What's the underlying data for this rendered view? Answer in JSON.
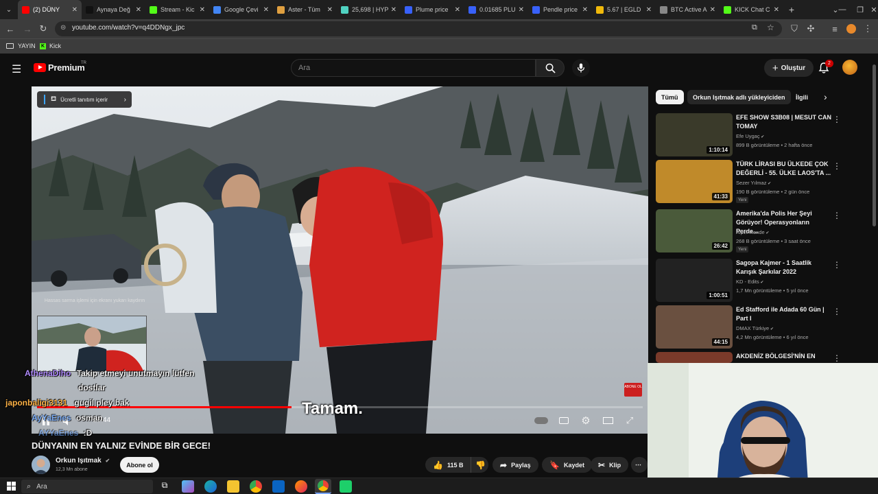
{
  "browser": {
    "tabs": [
      {
        "title": "(2) DÜNY",
        "color": "#ff0000",
        "active": true
      },
      {
        "title": "Aynaya Değ",
        "color": "#111111",
        "active": false
      },
      {
        "title": "Stream - Kic",
        "color": "#53fc18",
        "active": false
      },
      {
        "title": "Google Çevi",
        "color": "#4285f4",
        "active": false
      },
      {
        "title": "Aster - Tüm",
        "color": "#e0a040",
        "active": false
      },
      {
        "title": "25,698 | HYP",
        "color": "#50d2c1",
        "active": false
      },
      {
        "title": "Plume price",
        "color": "#3861fb",
        "active": false
      },
      {
        "title": "0.01685 PLU",
        "color": "#3861fb",
        "active": false
      },
      {
        "title": "Pendle price",
        "color": "#3861fb",
        "active": false
      },
      {
        "title": "5.67 | EGLD",
        "color": "#f0b90b",
        "active": false
      },
      {
        "title": "BTC Active A",
        "color": "#888888",
        "active": false
      },
      {
        "title": "KICK Chat C",
        "color": "#53fc18",
        "active": false
      }
    ],
    "url": "youtube.com/watch?v=q4DDNgx_jpc",
    "bookmarks": [
      {
        "label": "YAYIN",
        "icon": "folder-icon"
      },
      {
        "label": "Kick",
        "icon": "kick-icon"
      }
    ]
  },
  "youtube": {
    "logo_text": "Premium",
    "logo_sup": "TR",
    "search_placeholder": "Ara",
    "create_label": "Oluştur",
    "notification_count": "2"
  },
  "player": {
    "promo_label": "Ücretli tanıtım içerir",
    "subtitle": "Tamam.",
    "time": "29:44",
    "progress": 0.42,
    "privacy_note": "Hassas sarma işlemi için ekranı yukarı kaydırın",
    "watermark": "ABONE OL"
  },
  "chat": [
    {
      "user": "AthenaDiho",
      "message": "Takip etmeyi unutmayın lütfen",
      "user_color": "#b18cff"
    },
    {
      "user": "",
      "message": "dostlar",
      "user_color": "#ffffff"
    },
    {
      "user": "japonbaligi3131",
      "message": "gugil pley bak",
      "user_color": "#ffb347"
    },
    {
      "user": "AyYaEnes",
      "message": "osman",
      "user_color": "#6ea8ff"
    },
    {
      "user": "AYYaEnes",
      "message": ":D",
      "user_color": "#6ea8ff"
    }
  ],
  "video": {
    "title": "DÜNYANIN EN YALNIZ EVİNDE BİR GECE!",
    "channel": "Orkun Işıtmak",
    "subscribers": "12,3 Mn abone",
    "subscribe_label": "Abone ol",
    "likes": "115 B",
    "share_label": "Paylaş",
    "save_label": "Kaydet",
    "clip_label": "Klip"
  },
  "sidebar": {
    "chips": [
      "Tümü",
      "Orkun Işıtmak adlı yükleyiciden",
      "İlgili"
    ],
    "recommendations": [
      {
        "title": "EFE SHOW S3B08 | MESUT CAN TOMAY",
        "channel": "Efe Uygaç",
        "meta": "899 B görüntüleme • 2 hafta önce",
        "duration": "1:10:14",
        "new": "",
        "thumb_color": "#3a3a2a"
      },
      {
        "title": "TÜRK LİRASI BU ÜLKEDE ÇOK DEĞERLİ - 55. ÜLKE LAOS'TA ...",
        "channel": "Sezer Yılmaz",
        "meta": "190 B görüntüleme • 2 gün önce",
        "duration": "41:33",
        "new": "Yeni",
        "thumb_color": "#c08a2a"
      },
      {
        "title": "Amerika'da Polis Her Şeyi Görüyor! Operasyonların Perde...",
        "channel": "Alper Rende",
        "meta": "268 B görüntüleme • 3 saat önce",
        "duration": "26:42",
        "new": "Yeni",
        "thumb_color": "#4a5a3a"
      },
      {
        "title": "Sagopa Kajmer - 1 Saatlik Karışık Şarkılar 2022",
        "channel": "KD - Edits",
        "meta": "1,7 Mn görüntüleme • 5 yıl önce",
        "duration": "1:00:51",
        "new": "",
        "thumb_color": "#222222"
      },
      {
        "title": "Ed Stafford ile Adada 60 Gün | Part I",
        "channel": "DMAX Türkiye",
        "meta": "4,2 Mn görüntüleme • 6 yıl önce",
        "duration": "44:15",
        "new": "",
        "thumb_color": "#6a5040"
      },
      {
        "title": "AKDENİZ BÖLGESİ'NİN EN",
        "channel": "",
        "meta": "",
        "duration": "",
        "new": "",
        "thumb_color": "#7a3a2a"
      }
    ]
  },
  "taskbar": {
    "search_placeholder": "Ara"
  }
}
